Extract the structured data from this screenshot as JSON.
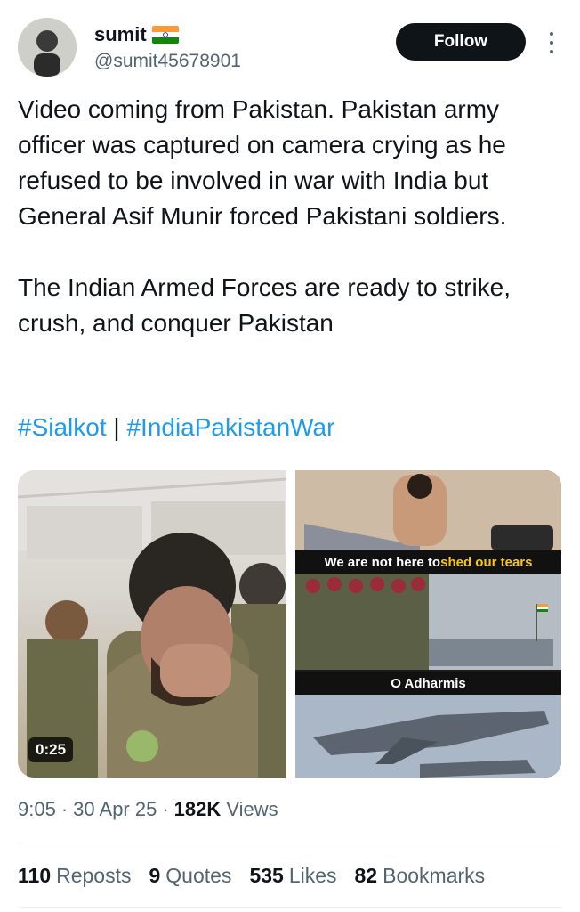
{
  "author": {
    "name": "sumit",
    "flag_icon": "india-flag-icon",
    "handle": "@sumit45678901",
    "follow_label": "Follow",
    "more_icon": "more-vertical-icon"
  },
  "tweet": {
    "text": "Video coming from Pakistan. Pakistan army officer was captured on camera crying as he refused to be involved in war with India but General Asif Munir forced Pakistani soldiers.\n\nThe Indian Armed Forces are ready to strike, crush, and conquer Pakistan",
    "hashtags": [
      "#Sialkot",
      "#IndiaPakistanWar"
    ],
    "hashtag_separator": " | ",
    "hashtag_color": "#1d9bf0"
  },
  "media": {
    "video_duration": "0:25",
    "caption_1_plain": "We are not here to ",
    "caption_1_highlight": "shed our tears",
    "caption_2": "O Adharmis"
  },
  "meta": {
    "time": "9:05",
    "dot1": "·",
    "date": "30 Apr 25",
    "dot2": "·",
    "views_count": "182K",
    "views_label": "Views"
  },
  "stats": [
    {
      "count": "110",
      "label": "Reposts"
    },
    {
      "count": "9",
      "label": "Quotes"
    },
    {
      "count": "535",
      "label": "Likes"
    },
    {
      "count": "82",
      "label": "Bookmarks"
    }
  ]
}
